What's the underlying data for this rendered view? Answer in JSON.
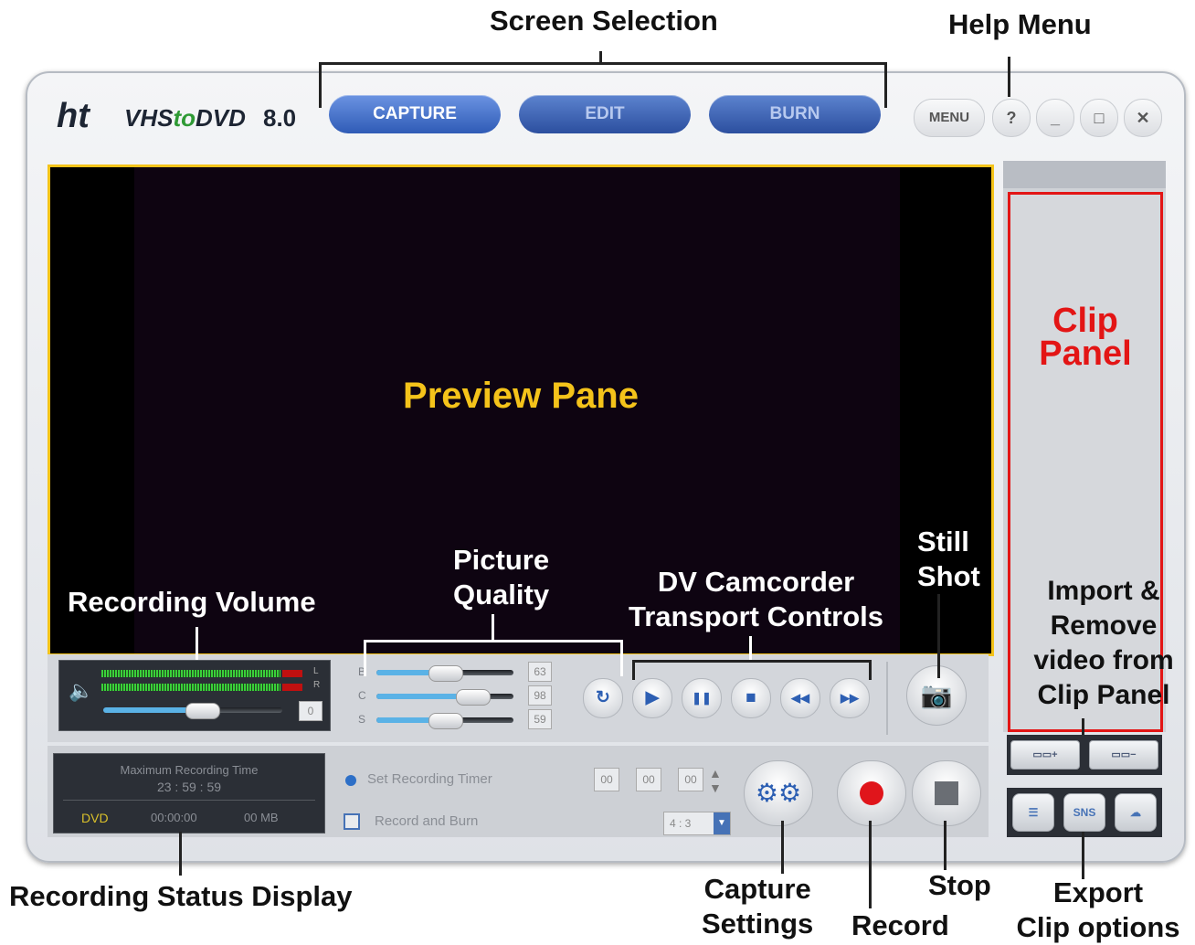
{
  "callouts": {
    "screen_selection": "Screen Selection",
    "help_menu": "Help Menu",
    "recording_volume": "Recording Volume",
    "picture_quality_1": "Picture",
    "picture_quality_2": "Quality",
    "dv_camcorder_1": "DV Camcorder",
    "dv_camcorder_2": "Transport Controls",
    "still_shot_1": "Still",
    "still_shot_2": "Shot",
    "import_remove_1": "Import &",
    "import_remove_2": "Remove",
    "import_remove_3": "video from",
    "import_remove_4": "Clip Panel",
    "recording_status": "Recording Status Display",
    "capture_settings_1": "Capture",
    "capture_settings_2": "Settings",
    "record": "Record",
    "stop": "Stop",
    "export_1": "Export",
    "export_2": "Clip options"
  },
  "app": {
    "logo_ht": "ht",
    "logo_vhs": "VHS",
    "logo_to": "to",
    "logo_dvd": "DVD",
    "version": "8.0"
  },
  "tabs": [
    {
      "label": "CAPTURE",
      "active": true
    },
    {
      "label": "EDIT",
      "active": false
    },
    {
      "label": "BURN",
      "active": false
    }
  ],
  "window_buttons": {
    "menu": "MENU",
    "help": "?",
    "minimize": "_",
    "maximize": "□",
    "close": "✕"
  },
  "preview": {
    "label": "Preview Pane"
  },
  "clip_panel": {
    "label_1": "Clip",
    "label_2": "Panel"
  },
  "volume": {
    "left_ch": "L",
    "right_ch": "R",
    "value": "0",
    "level": 0.55
  },
  "picture_quality": {
    "rows": [
      {
        "label": "B",
        "value": "63",
        "level": 0.5
      },
      {
        "label": "C",
        "value": "98",
        "level": 0.7
      },
      {
        "label": "S",
        "value": "59",
        "level": 0.5
      }
    ]
  },
  "transport": {
    "reset_icon": "↻",
    "play_icon": "▶",
    "pause_icon": "❚❚",
    "stop_icon": "■",
    "rewind_icon": "◀◀",
    "forward_icon": "▶▶"
  },
  "status": {
    "max_label": "Maximum Recording Time",
    "max_time": "23 : 59 : 59",
    "format": "DVD",
    "elapsed": "00:00:00",
    "size": "00 MB"
  },
  "timer": {
    "set_label": "Set Recording Timer",
    "hh": "00",
    "mm": "00",
    "ss": "00",
    "record_burn_label": "Record and Burn",
    "aspect": "4 : 3"
  },
  "clip_buttons": {
    "import": "▭▭+",
    "remove": "▭▭−",
    "export_file": "☰",
    "export_sns": "SNS",
    "export_cloud": "☁"
  },
  "colors": {
    "preview_border": "#f4c31a",
    "clip_panel_border": "#e31515",
    "tab_blue": "#2f5bb6",
    "record_red": "#e0151b"
  }
}
